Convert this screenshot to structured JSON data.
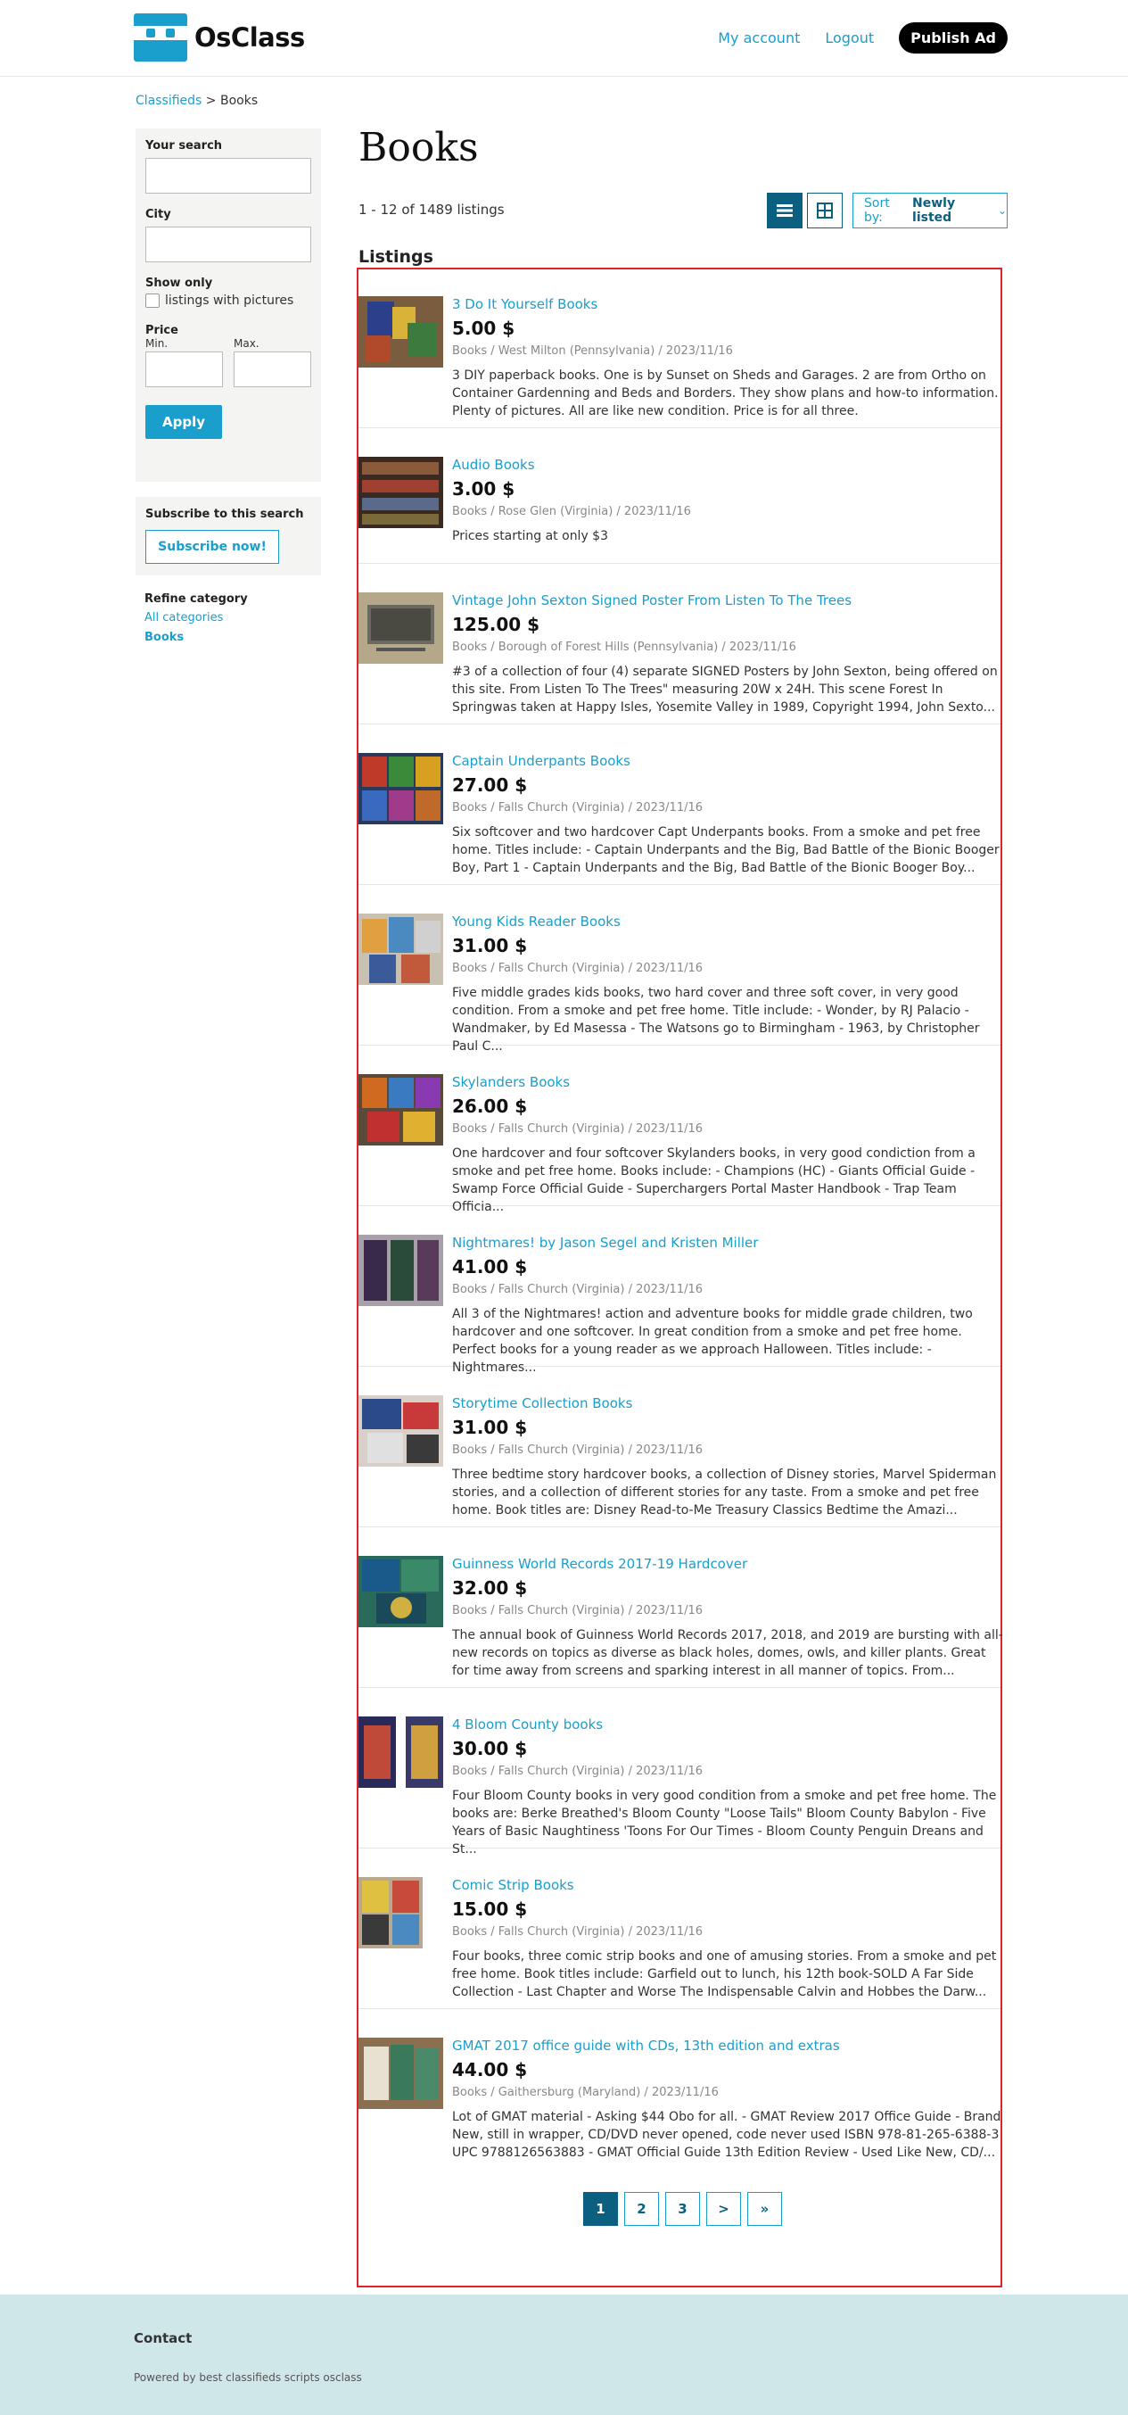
{
  "header": {
    "logo_text": "OsClass",
    "nav": {
      "my_account": "My account",
      "logout": "Logout",
      "publish": "Publish Ad"
    }
  },
  "breadcrumb": {
    "root": "Classifieds",
    "sep": " > ",
    "current": "Books"
  },
  "sidebar": {
    "your_search": "Your search",
    "city": "City",
    "show_only": "Show only",
    "with_pictures": "listings with pictures",
    "price": "Price",
    "min": "Min.",
    "max": "Max.",
    "apply": "Apply",
    "subscribe_title": "Subscribe to this search",
    "subscribe_btn": "Subscribe now!",
    "refine_title": "Refine category",
    "all_categories": "All categories",
    "current_category": "Books"
  },
  "main": {
    "title": "Books",
    "count": "1 - 12 of 1489 listings",
    "sort_label": "Sort by:",
    "sort_value": "Newly listed",
    "listings_heading": "Listings"
  },
  "listings": [
    {
      "title": "3 Do It Yourself Books",
      "price": "5.00 $",
      "meta": "Books   /   West Milton (Pennsylvania)   /   2023/11/16",
      "desc": "3 DIY paperback books. One is by Sunset on Sheds and Garages. 2 are from Ortho on Container Gardenning and Beds and Borders. They show plans and how-to information. Plenty of pictures. All are like new condition. Price is for all three."
    },
    {
      "title": "Audio Books",
      "price": "3.00 $",
      "meta": "Books   /   Rose Glen (Virginia)   /   2023/11/16",
      "desc": "Prices starting at only $3"
    },
    {
      "title": "Vintage John Sexton Signed Poster From Listen To The Trees",
      "price": "125.00 $",
      "meta": "Books   /   Borough of Forest Hills (Pennsylvania)   /   2023/11/16",
      "desc": "#3 of a collection of four (4) separate SIGNED Posters by John Sexton, being offered on this site. From Listen To The Trees\" measuring 20W x 24H. This scene Forest In Springwas taken at Happy Isles, Yosemite Valley in 1989, Copyright 1994, John Sexto..."
    },
    {
      "title": "Captain Underpants Books",
      "price": "27.00 $",
      "meta": "Books   /   Falls Church (Virginia)   /   2023/11/16",
      "desc": "Six softcover and two hardcover Capt Underpants books. From a smoke and pet free home. Titles include: - Captain Underpants and the Big, Bad Battle of the Bionic Booger Boy, Part 1 - Captain Underpants and the Big, Bad Battle of the Bionic Booger Boy..."
    },
    {
      "title": "Young Kids Reader Books",
      "price": "31.00 $",
      "meta": "Books   /   Falls Church (Virginia)   /   2023/11/16",
      "desc": "Five middle grades kids books, two hard cover and three soft cover, in very good condition. From a smoke and pet free home. Title include: - Wonder, by RJ Palacio - Wandmaker, by Ed Masessa - The Watsons go to Birmingham - 1963, by Christopher Paul C..."
    },
    {
      "title": "Skylanders Books",
      "price": "26.00 $",
      "meta": "Books   /   Falls Church (Virginia)   /   2023/11/16",
      "desc": "One hardcover and four softcover Skylanders books, in very good condiction from a smoke and pet free home. Books include: - Champions (HC) - Giants Official Guide - Swamp Force Official Guide - Superchargers Portal Master Handbook - Trap Team Officia..."
    },
    {
      "title": "Nightmares! by Jason Segel and Kristen Miller",
      "price": "41.00 $",
      "meta": "Books   /   Falls Church (Virginia)   /   2023/11/16",
      "desc": "All 3 of the Nightmares! action and adventure books for middle grade children, two hardcover and one softcover. In great condition from a smoke and pet free home. Perfect books for a young reader as we approach Halloween. Titles include: - Nightmares..."
    },
    {
      "title": "Storytime Collection Books",
      "price": "31.00 $",
      "meta": "Books   /   Falls Church (Virginia)   /   2023/11/16",
      "desc": "Three bedtime story hardcover books, a collection of Disney stories, Marvel Spiderman stories, and a collection of different stories for any taste. From a smoke and pet free home. Book titles are: Disney Read-to-Me Treasury Classics Bedtime the Amazi..."
    },
    {
      "title": "Guinness World Records 2017-19 Hardcover",
      "price": "32.00 $",
      "meta": "Books   /   Falls Church (Virginia)   /   2023/11/16",
      "desc": "The annual book of Guinness World Records 2017, 2018, and 2019 are bursting with all-new records on topics as diverse as black holes, domes, owls, and killer plants. Great for time away from screens and sparking interest in all manner of topics. From..."
    },
    {
      "title": "4 Bloom County books",
      "price": "30.00 $",
      "meta": "Books   /   Falls Church (Virginia)   /   2023/11/16",
      "desc": "Four Bloom County books in very good condition from a smoke and pet free home. The books are: Berke Breathed's Bloom County \"Loose Tails\" Bloom County Babylon - Five Years of Basic Naughtiness 'Toons For Our Times - Bloom County Penguin Dreans and St..."
    },
    {
      "title": "Comic Strip Books",
      "price": "15.00 $",
      "meta": "Books   /   Falls Church (Virginia)   /   2023/11/16",
      "desc": "Four books, three comic strip books and one of amusing stories. From a smoke and pet free home. Book titles include: Garfield out to lunch, his 12th book-SOLD A Far Side Collection - Last Chapter and Worse The Indispensable Calvin and Hobbes the Darw..."
    },
    {
      "title": "GMAT 2017 office guide with CDs, 13th edition and extras",
      "price": "44.00 $",
      "meta": "Books   /   Gaithersburg (Maryland)   /   2023/11/16",
      "desc": "Lot of GMAT material - Asking $44 Obo for all. - GMAT Review 2017 Office Guide - Brand New, still in wrapper, CD/DVD never opened, code never used ISBN 978-81-265-6388-3 UPC 9788126563883 - GMAT Official Guide 13th Edition Review - Used Like New, CD/..."
    }
  ],
  "pagination": [
    "1",
    "2",
    "3",
    ">",
    "»"
  ],
  "footer": {
    "contact": "Contact",
    "powered": "Powered by best classifieds scripts osclass"
  },
  "colors": {
    "accent": "#1a9ecc",
    "dark_accent": "#0b5f80",
    "frame": "#e0242c",
    "footer_bg": "#cfe7e8"
  }
}
